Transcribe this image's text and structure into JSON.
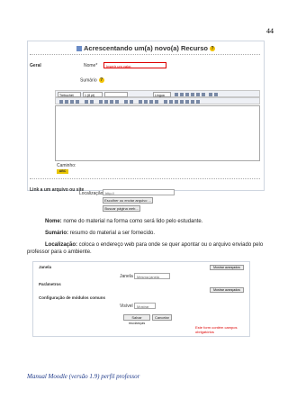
{
  "page_number": "44",
  "screenshot1": {
    "title": "Acrescentando um(a) novo(a) Recurso",
    "section_geral": "Geral",
    "nome_label": "Nome*",
    "nome_value": "Inserir um valor.",
    "sumario_label": "Sumário",
    "toolbar": {
      "font": "Trebuchet",
      "size": "1 (8 pt)",
      "lang": "Língua"
    },
    "path_label": "Caminho:",
    "section_link": "Link a um arquivo ou site",
    "localizacao_label": "Localização",
    "localizacao_value": "http://",
    "btn_escolher": "Escolher ou enviar arquivo ...",
    "btn_buscar": "Buscar página web..."
  },
  "descriptions": [
    {
      "term": "Nome:",
      "text": " nome do material na forma como será lido pelo estudante."
    },
    {
      "term": "Sumário:",
      "text": " resumo do material a ser fornecido."
    },
    {
      "term": "Localização:",
      "text": " coloca o endereço web para onde se quer apontar ou o arquivo enviado pelo professor para o ambiente."
    }
  ],
  "screenshot2": {
    "janela_section": "Janela",
    "janela_label": "Janela",
    "janela_value": "Mesma janela",
    "mostrar_avancados": "Mostrar avançados",
    "parametros_section": "Parâmetros",
    "modulos_section": "Configuração de módulos comuns",
    "visivel_label": "Visível",
    "visivel_value": "Mostrar",
    "btn_salvar": "Salvar mudanças",
    "btn_cancelar": "Cancelar",
    "required_note": "Este form contém campos obrigatórios"
  },
  "footer": "Manual Moodle (versão 1.9) perfil professor"
}
